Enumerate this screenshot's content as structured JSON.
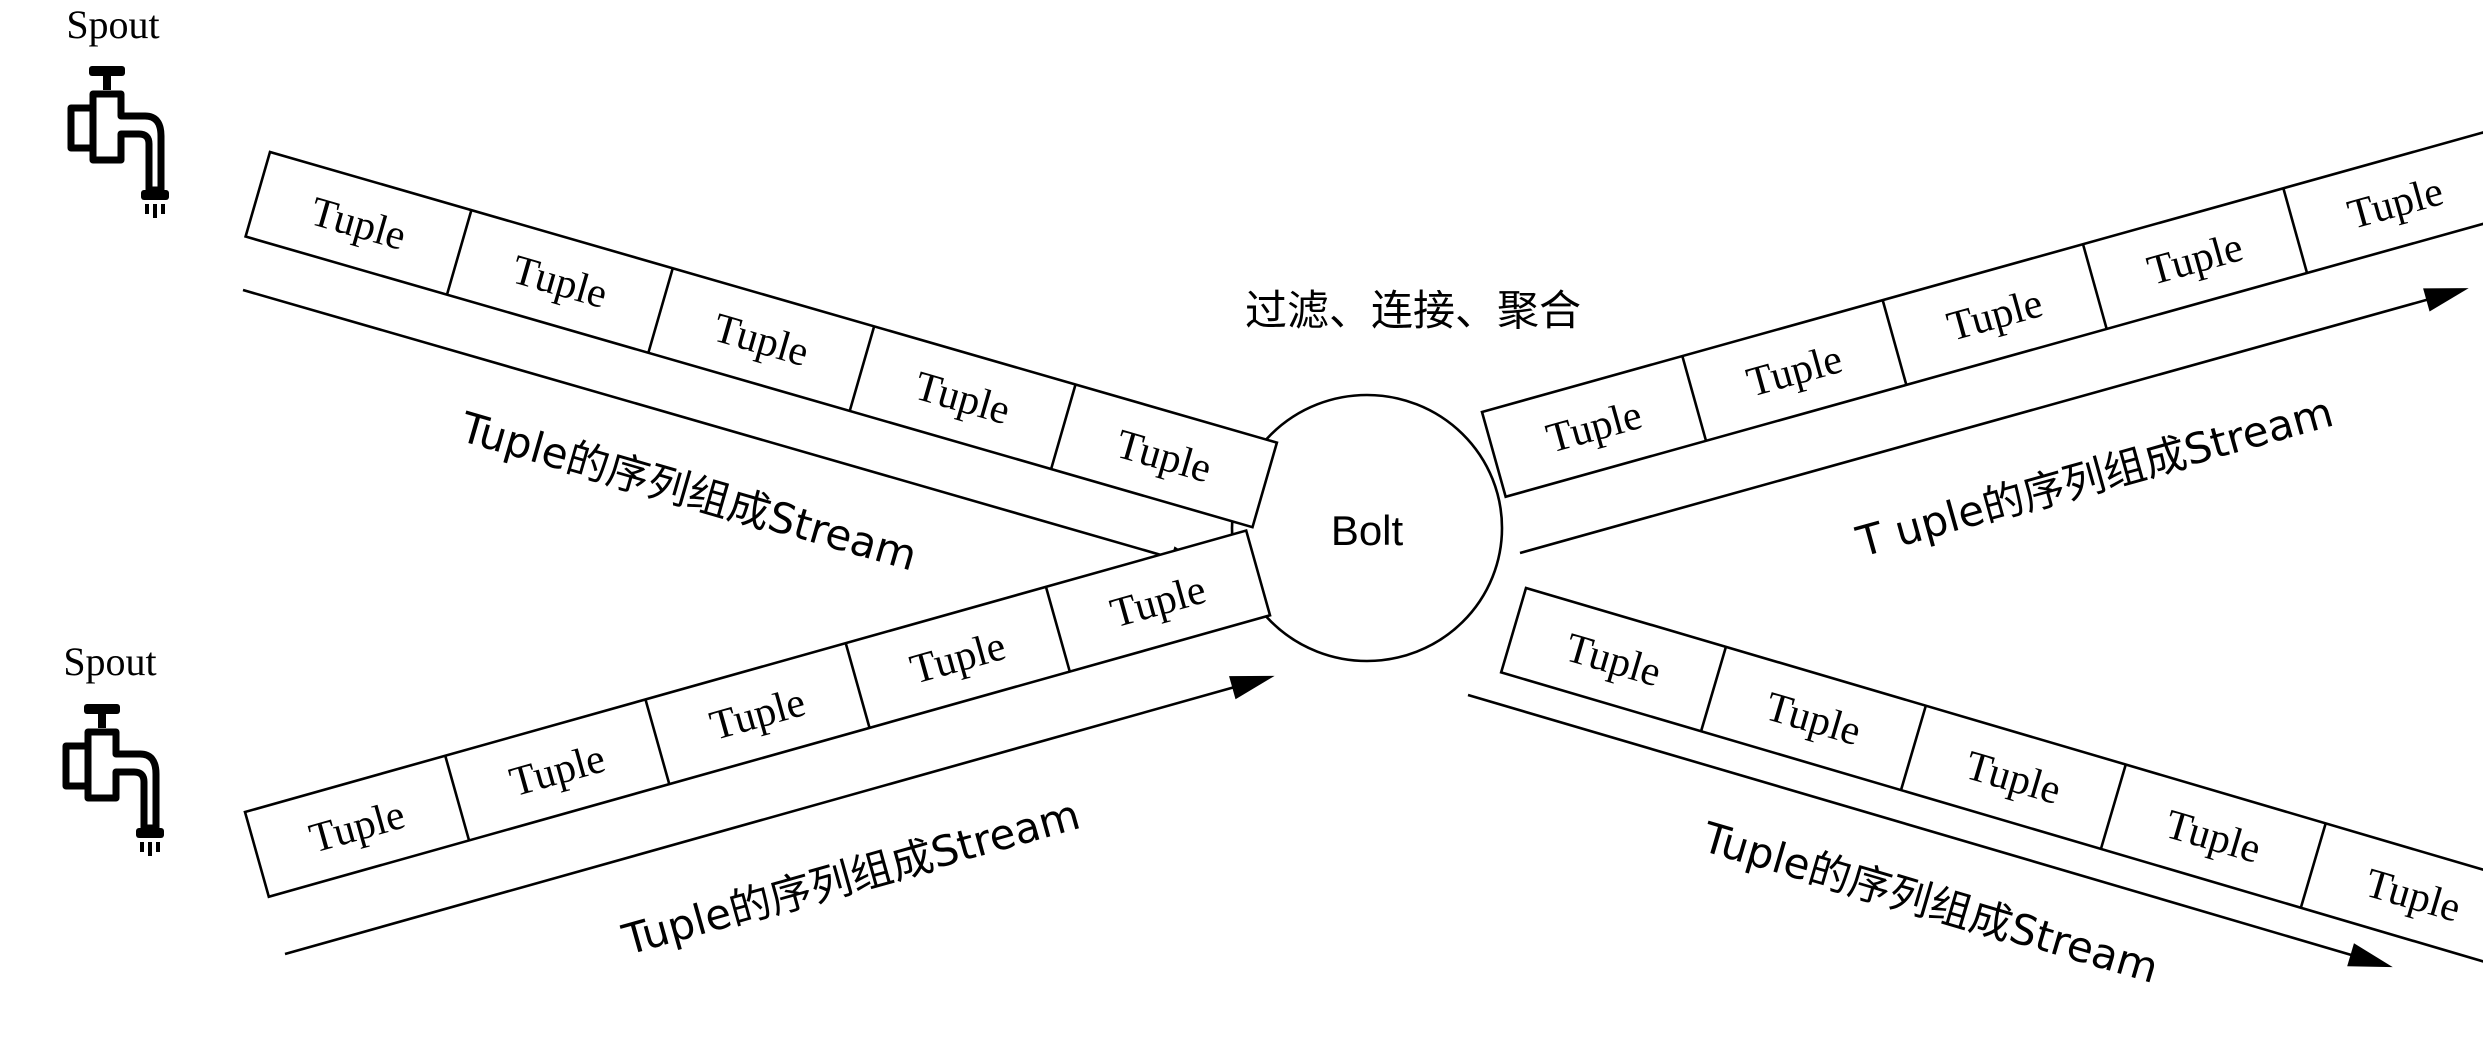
{
  "spouts": [
    {
      "label": "Spout"
    },
    {
      "label": "Spout"
    }
  ],
  "bolt": {
    "label": "Bolt"
  },
  "bolt_caption": "过滤、连接、聚合",
  "streams": [
    {
      "id": "upper-left",
      "tuples": [
        "Tuple",
        "Tuple",
        "Tuple",
        "Tuple",
        "Tuple"
      ],
      "caption": "Tuple的序列组成Stream"
    },
    {
      "id": "lower-left",
      "tuples": [
        "Tuple",
        "Tuple",
        "Tuple",
        "Tuple",
        "Tuple"
      ],
      "caption": "Tuple的序列组成Stream"
    },
    {
      "id": "upper-right",
      "tuples": [
        "Tuple",
        "Tuple",
        "Tuple",
        "Tuple",
        "Tuple"
      ],
      "caption": "T uple的序列组成Stream"
    },
    {
      "id": "lower-right",
      "tuples": [
        "Tuple",
        "Tuple",
        "Tuple",
        "Tuple",
        "Tuple"
      ],
      "caption": "Tuple的序列组成Stream"
    }
  ]
}
